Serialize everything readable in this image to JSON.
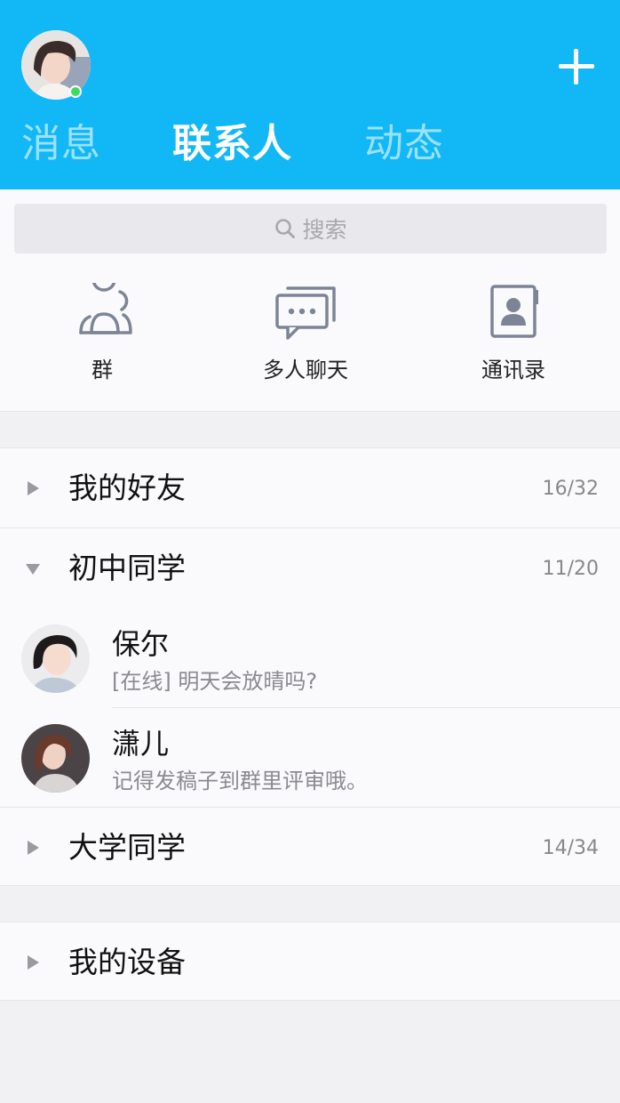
{
  "header": {
    "tabs": [
      {
        "label": "消息"
      },
      {
        "label": "联系人"
      },
      {
        "label": "动态"
      }
    ],
    "active_tab": "联系人",
    "background_color": "#12b7f5",
    "add_icon": "plus-icon",
    "status": "online"
  },
  "search": {
    "placeholder": "搜索",
    "icon": "search-icon"
  },
  "shortcuts": [
    {
      "label": "群",
      "icon": "group-icon"
    },
    {
      "label": "多人聊天",
      "icon": "chat-bubbles-icon"
    },
    {
      "label": "通讯录",
      "icon": "address-book-icon"
    }
  ],
  "groups": [
    {
      "name": "我的好友",
      "count": "16/32",
      "expanded": false
    },
    {
      "name": "初中同学",
      "count": "11/20",
      "expanded": true,
      "friends": [
        {
          "name": "保尔",
          "status": "[在线] 明天会放晴吗?"
        },
        {
          "name": "潇儿",
          "status": "记得发稿子到群里评审哦。"
        }
      ]
    },
    {
      "name": "大学同学",
      "count": "14/34",
      "expanded": false
    }
  ],
  "devices": {
    "name": "我的设备",
    "expanded": false
  }
}
